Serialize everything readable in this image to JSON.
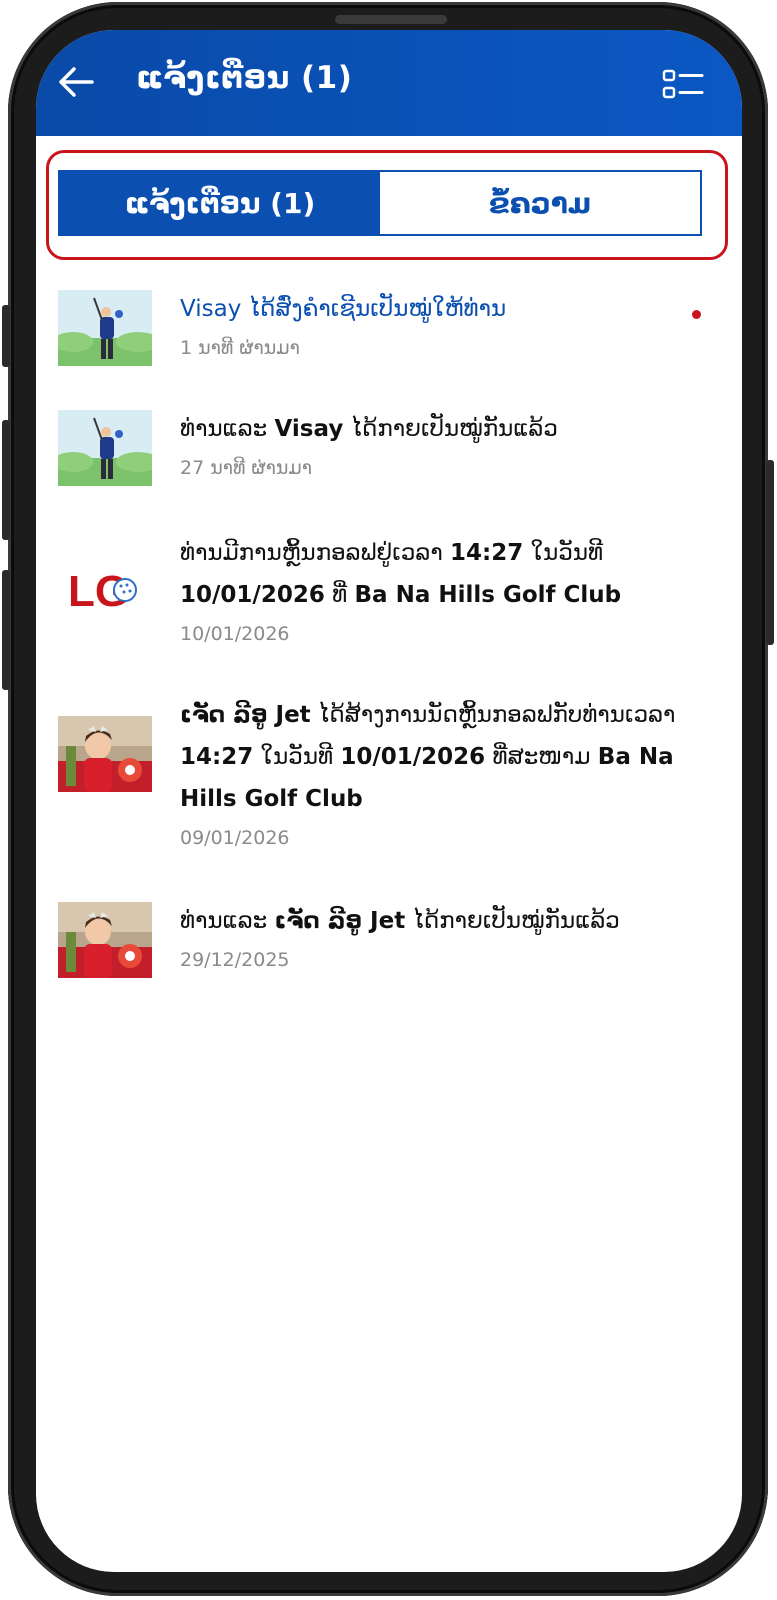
{
  "header": {
    "title": "ແຈ້ງເຕືອນ (1)"
  },
  "tabs": [
    {
      "label": "ແຈ້ງເຕືອນ (1)",
      "active": true
    },
    {
      "label": "ຂໍ້ຄວາມ",
      "active": false
    }
  ],
  "notifications": [
    {
      "parts": {
        "actor": "Visay",
        "rest": " ໄດ້ສົ່ງຄຳເຊີນເປັນໝູ່ໃຫ້ທ່ານ"
      },
      "time": "1 ນາທີ ຜ່ານມາ",
      "unread": true,
      "avatar": "golfer"
    },
    {
      "parts": {
        "pre": "ທ່ານແລະ ",
        "actor": "Visay",
        "rest": " ໄດ້ກາຍເປັນໝູ່ກັນແລ້ວ"
      },
      "time": "27 ນາທີ ຜ່ານມາ",
      "unread": false,
      "avatar": "golfer"
    },
    {
      "parts": {
        "pre": "ທ່ານມີການຫຼິ້ນກອລຟຢູ່ເວລາ ",
        "time_b": "14:27",
        "mid": " ໃນວັນທີ ",
        "date_b": "10/01/2026",
        "mid2": " ທີ່ ",
        "place_b": "Ba Na Hills Golf Club"
      },
      "time": "10/01/2026",
      "unread": false,
      "avatar": "LG",
      "logo_text": "LG"
    },
    {
      "parts": {
        "actor": "ເຈັດ ລີອູ Jet",
        "rest": " ໄດ້ສ້າງການນັດຫຼິ້ນກອລຟກັບທ່ານເວລາ ",
        "time_b": "14:27",
        "mid": " ໃນວັນທີ ",
        "date_b": "10/01/2026",
        "mid2": " ທີ່ສະໜາມ ",
        "place_b": "Ba Na Hills Golf Club"
      },
      "time": "09/01/2026",
      "unread": false,
      "avatar": "child"
    },
    {
      "parts": {
        "pre": "ທ່ານແລະ ",
        "actor": "ເຈັດ ລີອູ Jet",
        "rest": " ໄດ້ກາຍເປັນໝູ່ກັນແລ້ວ"
      },
      "time": "29/12/2025",
      "unread": false,
      "avatar": "child"
    }
  ],
  "colors": {
    "brand_blue": "#0b4fb0",
    "highlight_red": "#c8151b",
    "timestamp_gray": "#8a8a8a"
  }
}
